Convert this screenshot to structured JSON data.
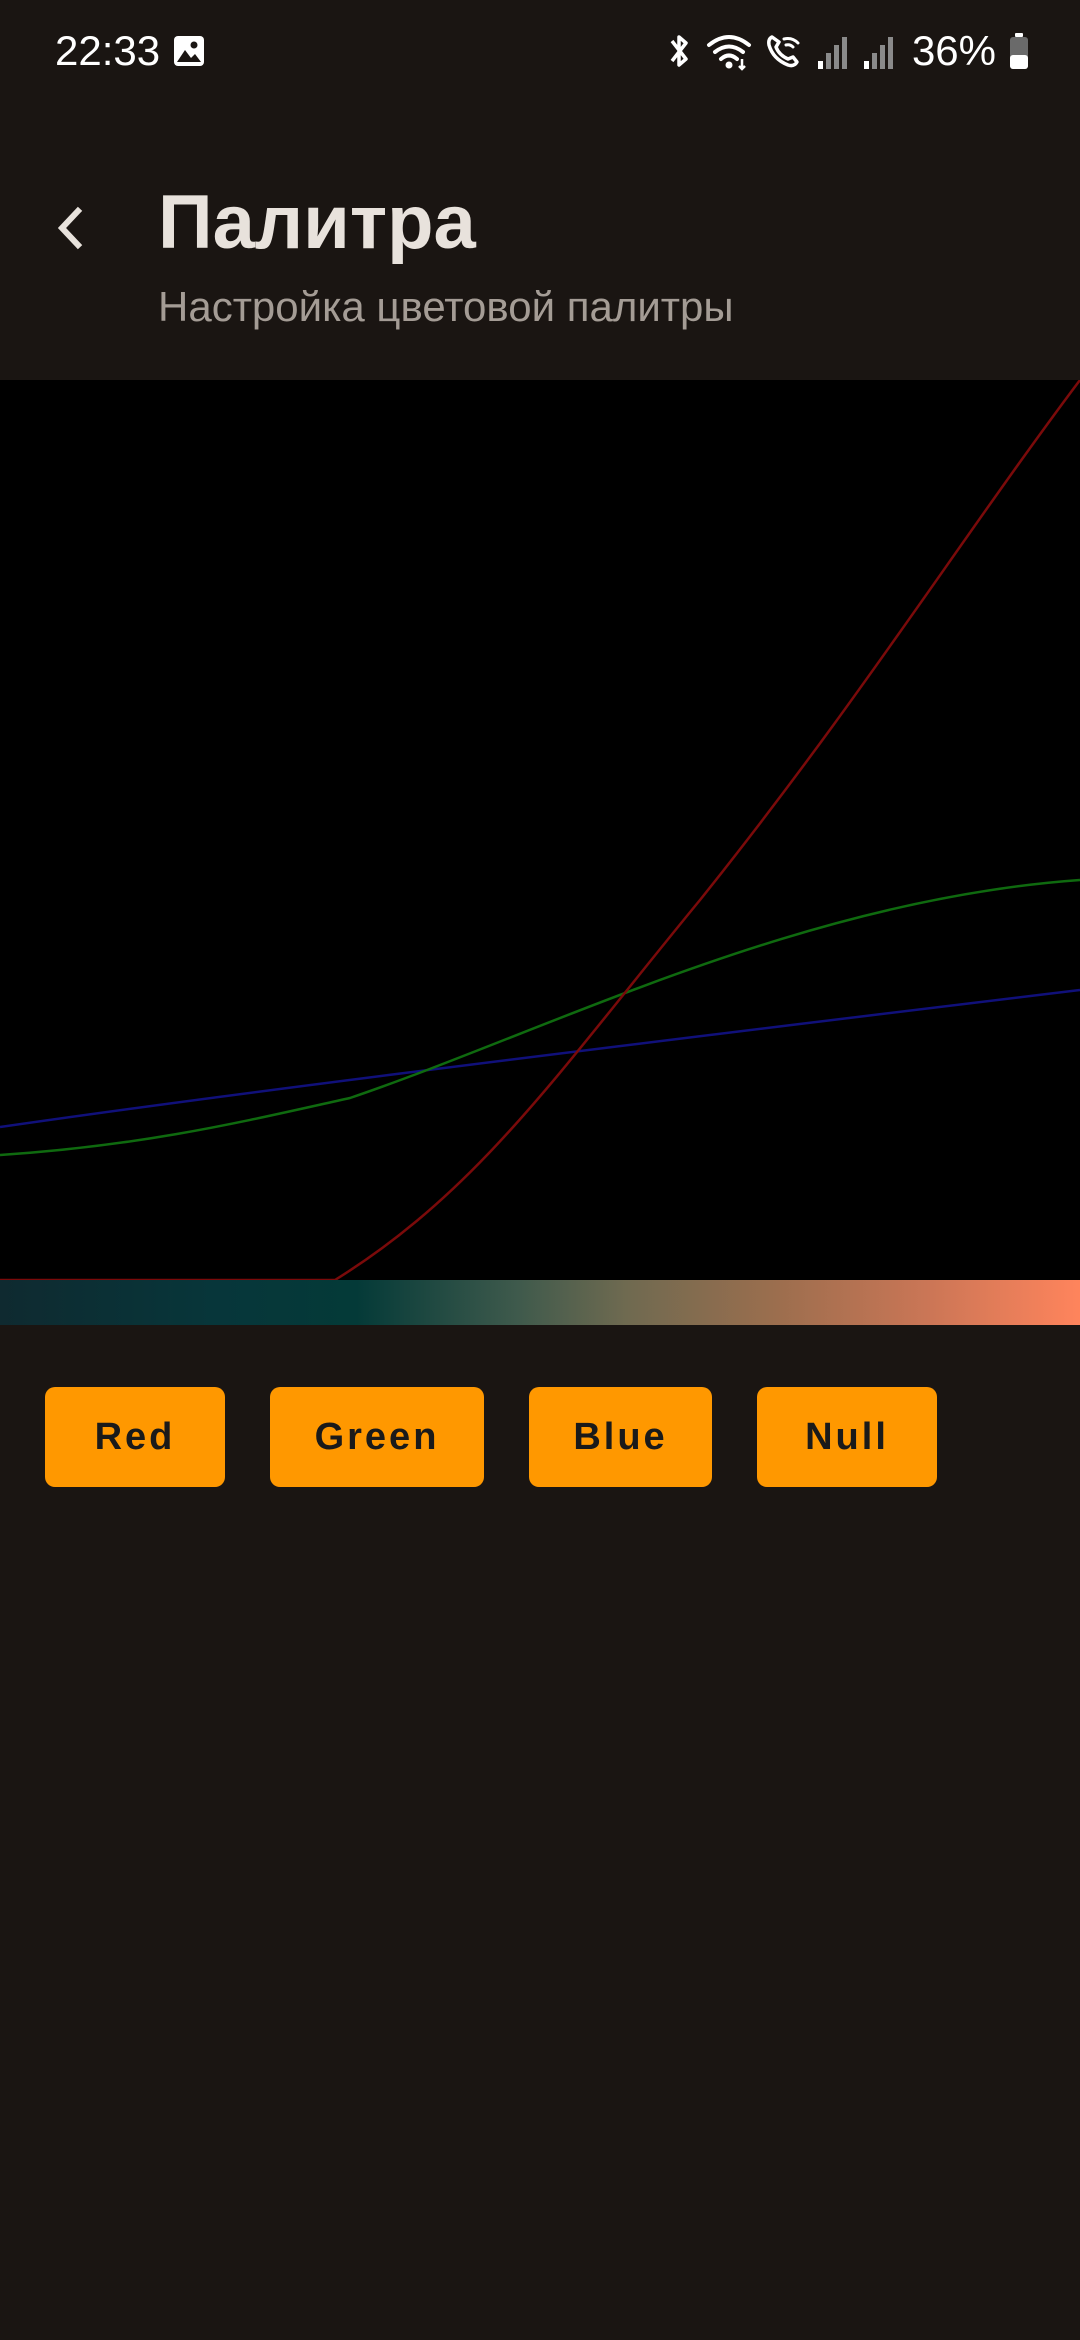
{
  "status_bar": {
    "time": "22:33",
    "battery": "36%",
    "icons": [
      "gallery-icon",
      "bluetooth-icon",
      "wifi-icon",
      "wifi-call-icon",
      "signal-icon",
      "signal-icon",
      "battery-icon"
    ]
  },
  "header": {
    "title": "Палитра",
    "subtitle": "Настройка цветовой палитры",
    "back_icon": "chevron-left-icon"
  },
  "colors": {
    "background": "#1a1512",
    "canvas": "#000000",
    "button": "#ff9800",
    "red_curve": "#7a0a0a",
    "green_curve": "#0f6a0f",
    "blue_curve": "#10107a",
    "gradient_start": "#0f2a30",
    "gradient_end": "#ff845c"
  },
  "buttons": [
    {
      "label": "Red"
    },
    {
      "label": "Green"
    },
    {
      "label": "Blue"
    },
    {
      "label": "Null"
    }
  ]
}
